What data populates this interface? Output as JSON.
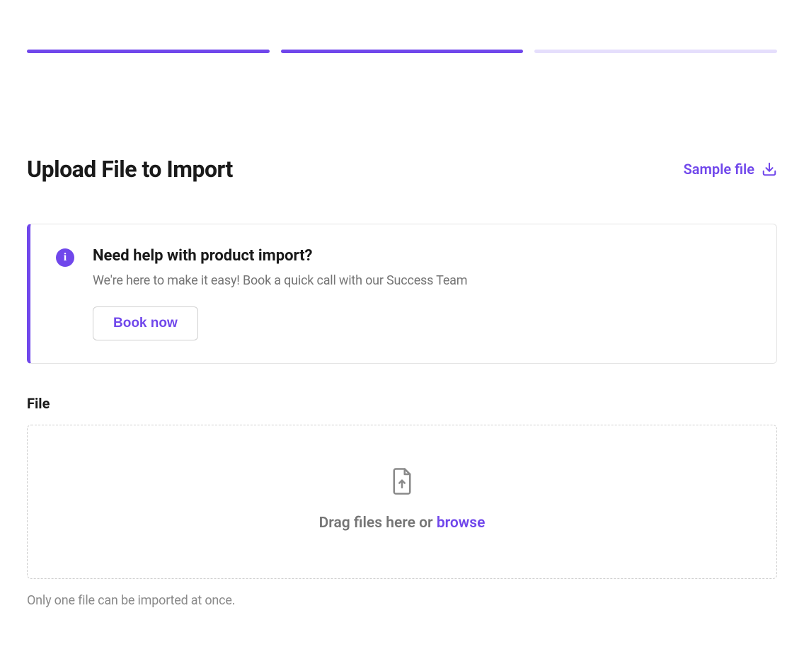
{
  "progress": {
    "segments": [
      {
        "active": true
      },
      {
        "active": true
      },
      {
        "active": false
      }
    ]
  },
  "header": {
    "title": "Upload File to Import",
    "sample_file_label": "Sample file"
  },
  "info_box": {
    "title": "Need help with product import?",
    "description": "We're here to make it easy! Book a quick call with our Success Team",
    "button_label": "Book now"
  },
  "file_section": {
    "label": "File",
    "dropzone_text_prefix": "Drag files here or ",
    "dropzone_browse": "browse",
    "hint": "Only one file can be imported at once."
  }
}
